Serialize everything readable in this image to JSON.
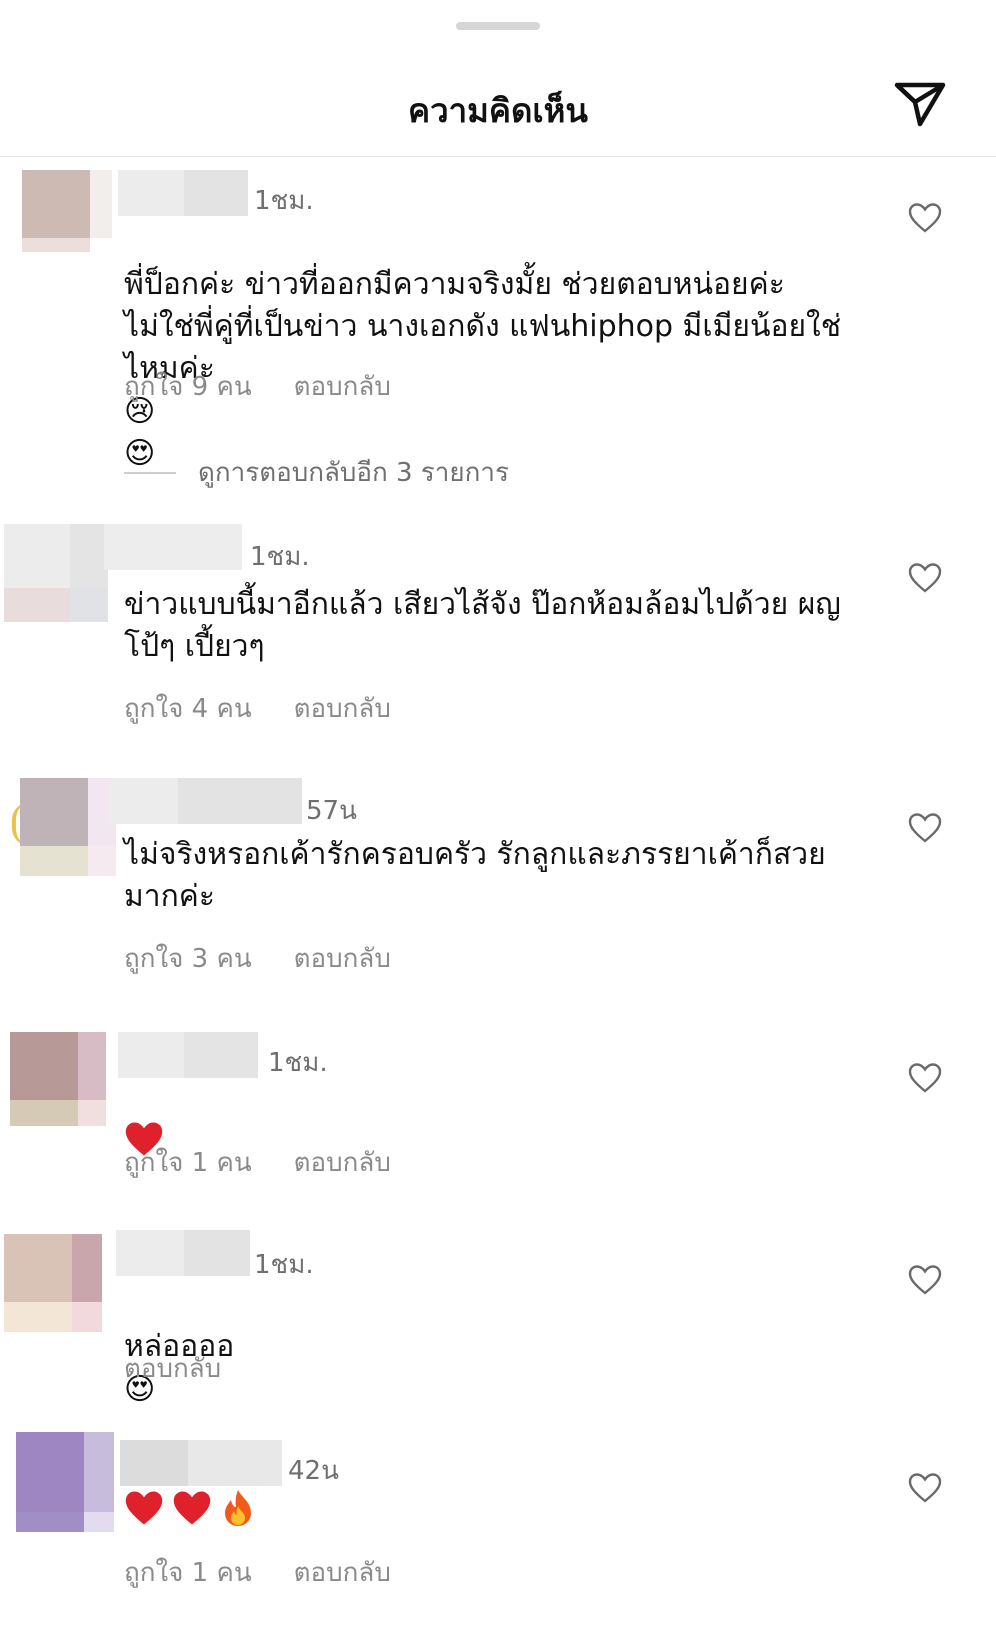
{
  "header": {
    "title": "ความคิดเห็น"
  },
  "comments": [
    {
      "time": "1ชม.",
      "text": "พี่ป็อกค่ะ ข่าวที่ออกมีความจริงมั้ย ช่วยตอบหน่อยค่ะ\nไม่ใช่พี่คู่ที่เป็นข่าว นางเอกดัง แฟนhiphop มีเมียน้อยใช่\nไหมค่ะ",
      "emojis": [
        "😢",
        "😍"
      ],
      "likes": "ถูกใจ 9 คน",
      "reply": "ตอบกลับ",
      "view_replies": "ดูการตอบกลับอีก 3 รายการ"
    },
    {
      "time": "1ชม.",
      "text": "ข่าวแบบนี้มาอีกแล้ว เสียวไส้จัง ป๊อกห้อมล้อมไปด้วย ผญ\nโป้ๆ เปี้ยวๆ",
      "likes": "ถูกใจ 4 คน",
      "reply": "ตอบกลับ"
    },
    {
      "time": "57น",
      "text": "ไม่จริงหรอกเค้ารักครอบครัว รักลูกและภรรยาเค้าก็สวย\nมากค่ะ",
      "likes": "ถูกใจ 3 คน",
      "reply": "ตอบกลับ"
    },
    {
      "time": "1ชม.",
      "text": "",
      "emojis": [
        "❤️"
      ],
      "likes": "ถูกใจ 1 คน",
      "reply": "ตอบกลับ"
    },
    {
      "time": "1ชม.",
      "text": "หล่ออออ",
      "emojis": [
        "😍"
      ],
      "reply": "ตอบกลับ"
    },
    {
      "time": "42น",
      "text": "",
      "emojis": [
        "❤️",
        "❤️",
        "🔥"
      ],
      "likes": "ถูกใจ 1 คน",
      "reply": "ตอบกลับ"
    }
  ],
  "colors": {
    "heart_red": "#e0202a",
    "face_yellow": "#f7c23a",
    "muted_text": "#8a8a8a"
  }
}
